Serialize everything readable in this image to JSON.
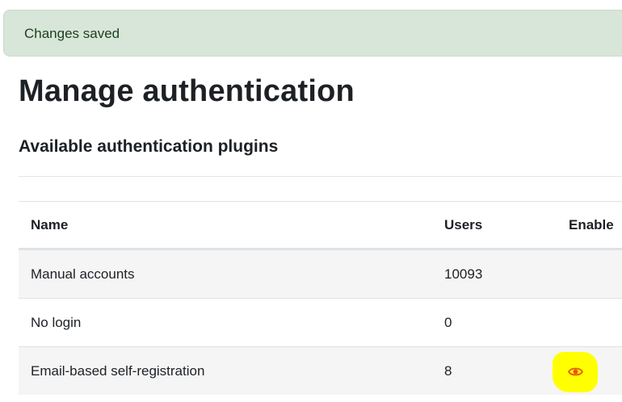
{
  "alert": {
    "message": "Changes saved"
  },
  "page": {
    "title": "Manage authentication"
  },
  "section": {
    "title": "Available authentication plugins"
  },
  "table": {
    "headers": {
      "name": "Name",
      "users": "Users",
      "enable": "Enable"
    },
    "rows": [
      {
        "name": "Manual accounts",
        "users": "10093"
      },
      {
        "name": "No login",
        "users": "0"
      },
      {
        "name": "Email-based self-registration",
        "users": "8",
        "enable_icon": "eye-icon"
      }
    ]
  },
  "colors": {
    "alert_bg": "#d7e6d8",
    "highlight": "#ffff00",
    "eye_icon": "#e8590c"
  }
}
